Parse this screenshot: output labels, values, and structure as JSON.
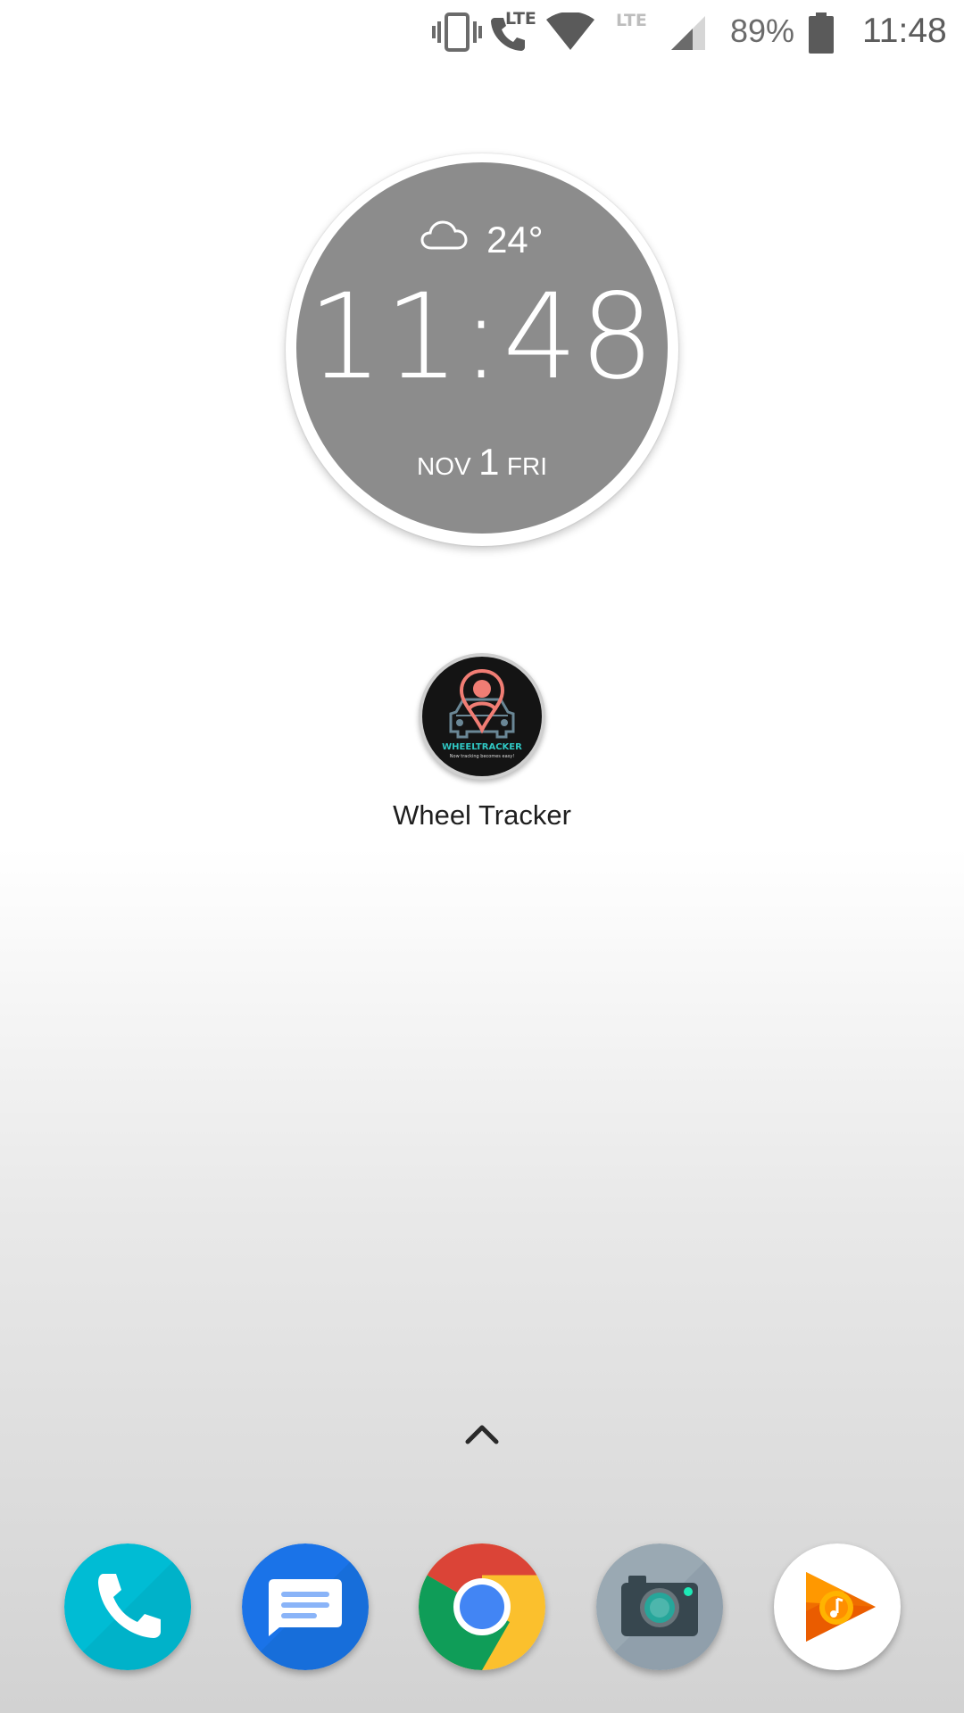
{
  "status_bar": {
    "icons": [
      "vibrate-icon",
      "volte-call-icon",
      "wifi-icon",
      "lte-signal-icon",
      "battery-icon"
    ],
    "lte_label_1": "LTE",
    "lte_label_2": "LTE",
    "battery_percent": "89%",
    "time": "11:48"
  },
  "clock_widget": {
    "weather_icon": "cloud-icon",
    "temperature": "24°",
    "time": "11:48",
    "date_month": "NOV",
    "date_day": "1",
    "date_weekday": "FRI",
    "face_color": "#8c8c8c"
  },
  "home_apps": [
    {
      "label": "Wheel Tracker",
      "icon": "wheel-tracker-app-icon",
      "logo_text": "WHEELTRACKER",
      "logo_tagline": "Now tracking becomes easy!"
    }
  ],
  "all_apps_indicator": "chevron-up-icon",
  "dock": [
    {
      "name": "phone",
      "icon": "phone-app-icon",
      "color": "#00bcd4"
    },
    {
      "name": "messages",
      "icon": "messages-app-icon",
      "color": "#1a73e8"
    },
    {
      "name": "chrome",
      "icon": "chrome-app-icon",
      "color": "#4285f4"
    },
    {
      "name": "camera",
      "icon": "camera-app-icon",
      "color": "#9aa9b3"
    },
    {
      "name": "play-music",
      "icon": "play-music-app-icon",
      "color": "#ff6d00"
    }
  ]
}
